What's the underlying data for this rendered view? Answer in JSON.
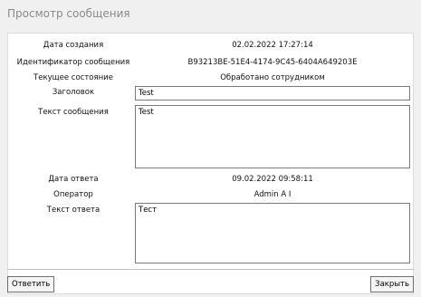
{
  "window": {
    "title": "Просмотр сообщения"
  },
  "fields": {
    "created_label": "Дата создания",
    "created_value": "02.02.2022 17:27:14",
    "id_label": "Идентификатор сообщения",
    "id_value": "B93213BE-51E4-4174-9C45-6404A649203E",
    "state_label": "Текущее состояние",
    "state_value": "Обработано сотрудником",
    "subject_label": "Заголовок",
    "subject_value": "Test",
    "message_label": "Текст сообщения",
    "message_value": "Test",
    "reply_date_label": "Дата ответа",
    "reply_date_value": "09.02.2022 09:58:11",
    "operator_label": "Оператор",
    "operator_value": "Admin A I",
    "reply_label": "Текст ответа",
    "reply_value": "Тест"
  },
  "buttons": {
    "reply_label": "Ответить",
    "close_label": "Закрыть"
  }
}
